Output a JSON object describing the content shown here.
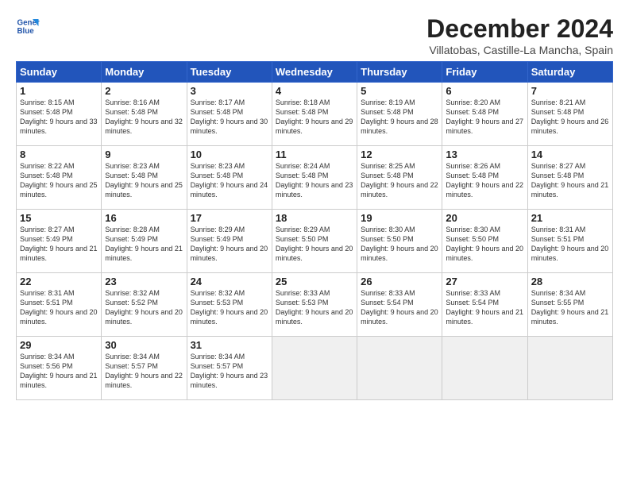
{
  "logo": {
    "line1": "General",
    "line2": "Blue"
  },
  "title": "December 2024",
  "subtitle": "Villatobas, Castille-La Mancha, Spain",
  "days_header": [
    "Sunday",
    "Monday",
    "Tuesday",
    "Wednesday",
    "Thursday",
    "Friday",
    "Saturday"
  ],
  "weeks": [
    [
      {
        "day": 1,
        "sunrise": "8:15 AM",
        "sunset": "5:48 PM",
        "daylight": "9 hours and 33 minutes."
      },
      {
        "day": 2,
        "sunrise": "8:16 AM",
        "sunset": "5:48 PM",
        "daylight": "9 hours and 32 minutes."
      },
      {
        "day": 3,
        "sunrise": "8:17 AM",
        "sunset": "5:48 PM",
        "daylight": "9 hours and 30 minutes."
      },
      {
        "day": 4,
        "sunrise": "8:18 AM",
        "sunset": "5:48 PM",
        "daylight": "9 hours and 29 minutes."
      },
      {
        "day": 5,
        "sunrise": "8:19 AM",
        "sunset": "5:48 PM",
        "daylight": "9 hours and 28 minutes."
      },
      {
        "day": 6,
        "sunrise": "8:20 AM",
        "sunset": "5:48 PM",
        "daylight": "9 hours and 27 minutes."
      },
      {
        "day": 7,
        "sunrise": "8:21 AM",
        "sunset": "5:48 PM",
        "daylight": "9 hours and 26 minutes."
      }
    ],
    [
      {
        "day": 8,
        "sunrise": "8:22 AM",
        "sunset": "5:48 PM",
        "daylight": "9 hours and 25 minutes."
      },
      {
        "day": 9,
        "sunrise": "8:23 AM",
        "sunset": "5:48 PM",
        "daylight": "9 hours and 25 minutes."
      },
      {
        "day": 10,
        "sunrise": "8:23 AM",
        "sunset": "5:48 PM",
        "daylight": "9 hours and 24 minutes."
      },
      {
        "day": 11,
        "sunrise": "8:24 AM",
        "sunset": "5:48 PM",
        "daylight": "9 hours and 23 minutes."
      },
      {
        "day": 12,
        "sunrise": "8:25 AM",
        "sunset": "5:48 PM",
        "daylight": "9 hours and 22 minutes."
      },
      {
        "day": 13,
        "sunrise": "8:26 AM",
        "sunset": "5:48 PM",
        "daylight": "9 hours and 22 minutes."
      },
      {
        "day": 14,
        "sunrise": "8:27 AM",
        "sunset": "5:48 PM",
        "daylight": "9 hours and 21 minutes."
      }
    ],
    [
      {
        "day": 15,
        "sunrise": "8:27 AM",
        "sunset": "5:49 PM",
        "daylight": "9 hours and 21 minutes."
      },
      {
        "day": 16,
        "sunrise": "8:28 AM",
        "sunset": "5:49 PM",
        "daylight": "9 hours and 21 minutes."
      },
      {
        "day": 17,
        "sunrise": "8:29 AM",
        "sunset": "5:49 PM",
        "daylight": "9 hours and 20 minutes."
      },
      {
        "day": 18,
        "sunrise": "8:29 AM",
        "sunset": "5:50 PM",
        "daylight": "9 hours and 20 minutes."
      },
      {
        "day": 19,
        "sunrise": "8:30 AM",
        "sunset": "5:50 PM",
        "daylight": "9 hours and 20 minutes."
      },
      {
        "day": 20,
        "sunrise": "8:30 AM",
        "sunset": "5:50 PM",
        "daylight": "9 hours and 20 minutes."
      },
      {
        "day": 21,
        "sunrise": "8:31 AM",
        "sunset": "5:51 PM",
        "daylight": "9 hours and 20 minutes."
      }
    ],
    [
      {
        "day": 22,
        "sunrise": "8:31 AM",
        "sunset": "5:51 PM",
        "daylight": "9 hours and 20 minutes."
      },
      {
        "day": 23,
        "sunrise": "8:32 AM",
        "sunset": "5:52 PM",
        "daylight": "9 hours and 20 minutes."
      },
      {
        "day": 24,
        "sunrise": "8:32 AM",
        "sunset": "5:53 PM",
        "daylight": "9 hours and 20 minutes."
      },
      {
        "day": 25,
        "sunrise": "8:33 AM",
        "sunset": "5:53 PM",
        "daylight": "9 hours and 20 minutes."
      },
      {
        "day": 26,
        "sunrise": "8:33 AM",
        "sunset": "5:54 PM",
        "daylight": "9 hours and 20 minutes."
      },
      {
        "day": 27,
        "sunrise": "8:33 AM",
        "sunset": "5:54 PM",
        "daylight": "9 hours and 21 minutes."
      },
      {
        "day": 28,
        "sunrise": "8:34 AM",
        "sunset": "5:55 PM",
        "daylight": "9 hours and 21 minutes."
      }
    ],
    [
      {
        "day": 29,
        "sunrise": "8:34 AM",
        "sunset": "5:56 PM",
        "daylight": "9 hours and 21 minutes."
      },
      {
        "day": 30,
        "sunrise": "8:34 AM",
        "sunset": "5:57 PM",
        "daylight": "9 hours and 22 minutes."
      },
      {
        "day": 31,
        "sunrise": "8:34 AM",
        "sunset": "5:57 PM",
        "daylight": "9 hours and 23 minutes."
      },
      null,
      null,
      null,
      null
    ]
  ]
}
